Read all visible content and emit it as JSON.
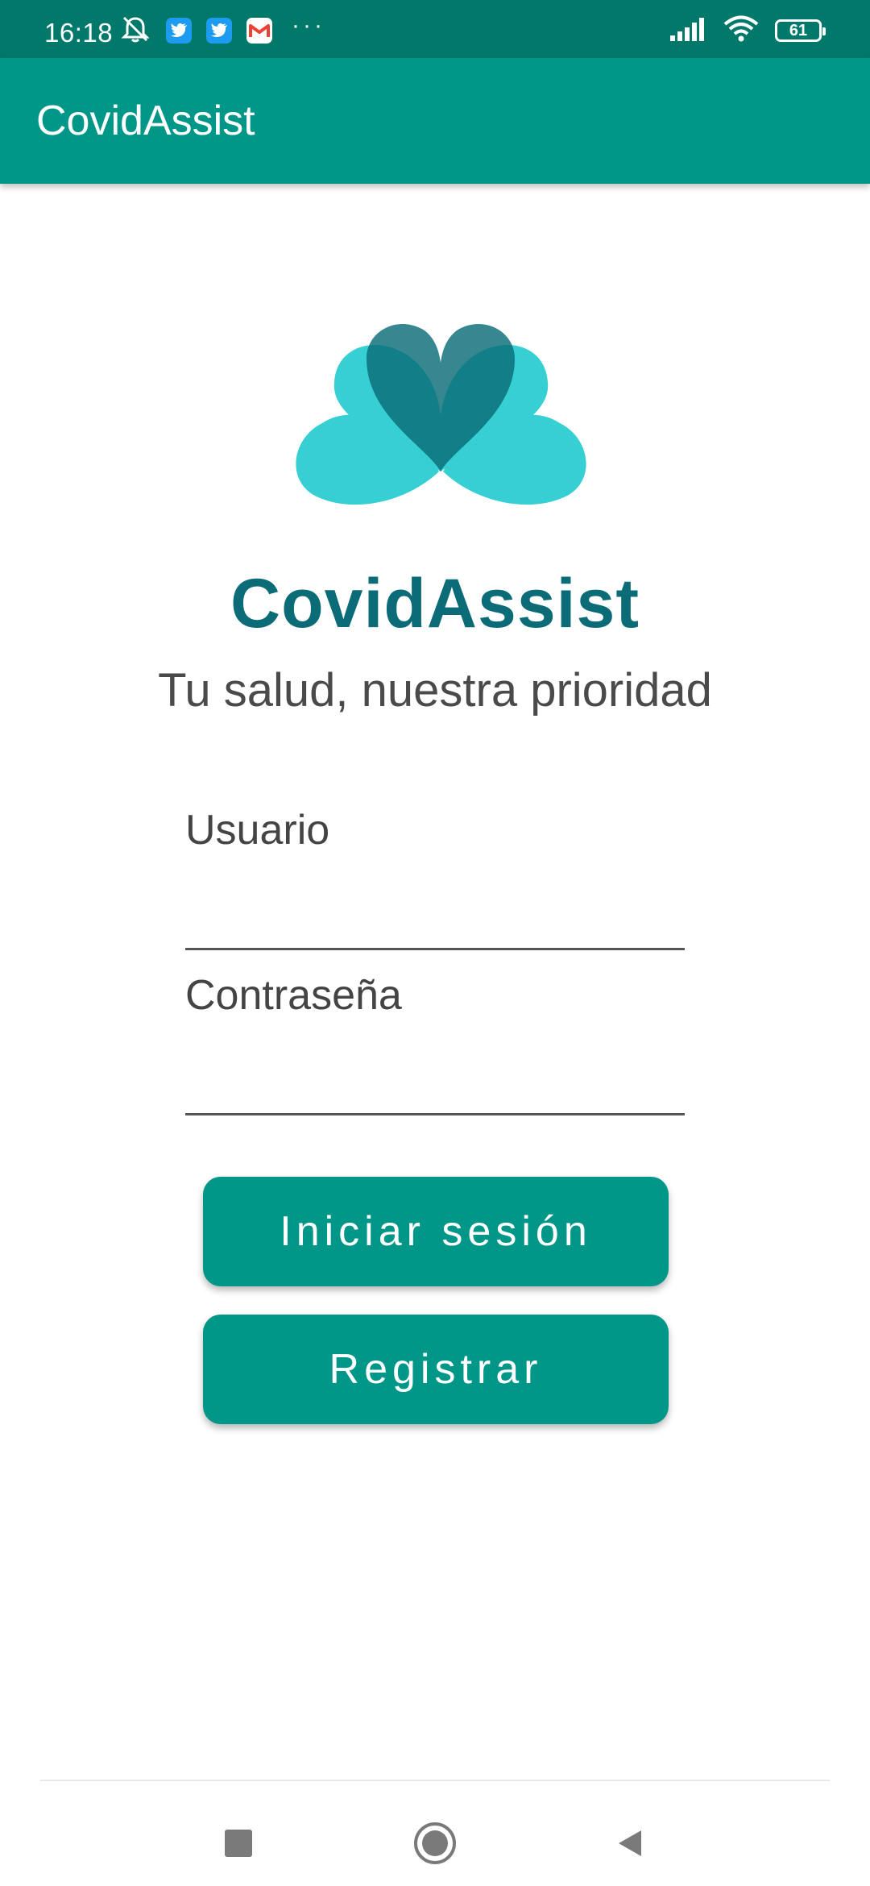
{
  "status_bar": {
    "time": "16:18",
    "battery": "61",
    "icons_left": [
      "mute-icon",
      "twitter-icon",
      "twitter-icon",
      "gmail-icon",
      "more-icon"
    ],
    "icons_right": [
      "signal-icon",
      "wifi-icon",
      "battery-icon"
    ]
  },
  "app_bar": {
    "title": "CovidAssist"
  },
  "logo": {
    "brand": "CovidAssist",
    "tagline": "Tu salud, nuestra prioridad",
    "colors": {
      "light": "#36cfd4",
      "dark": "#0b6c78"
    }
  },
  "form": {
    "username": {
      "label": "Usuario",
      "value": ""
    },
    "password": {
      "label": "Contraseña",
      "value": ""
    }
  },
  "buttons": {
    "login": "Iniciar sesión",
    "register": "Registrar"
  },
  "nav": [
    "recents-icon",
    "home-icon",
    "back-icon"
  ],
  "colors": {
    "primary": "#009688",
    "primary_dark": "#00796b"
  }
}
